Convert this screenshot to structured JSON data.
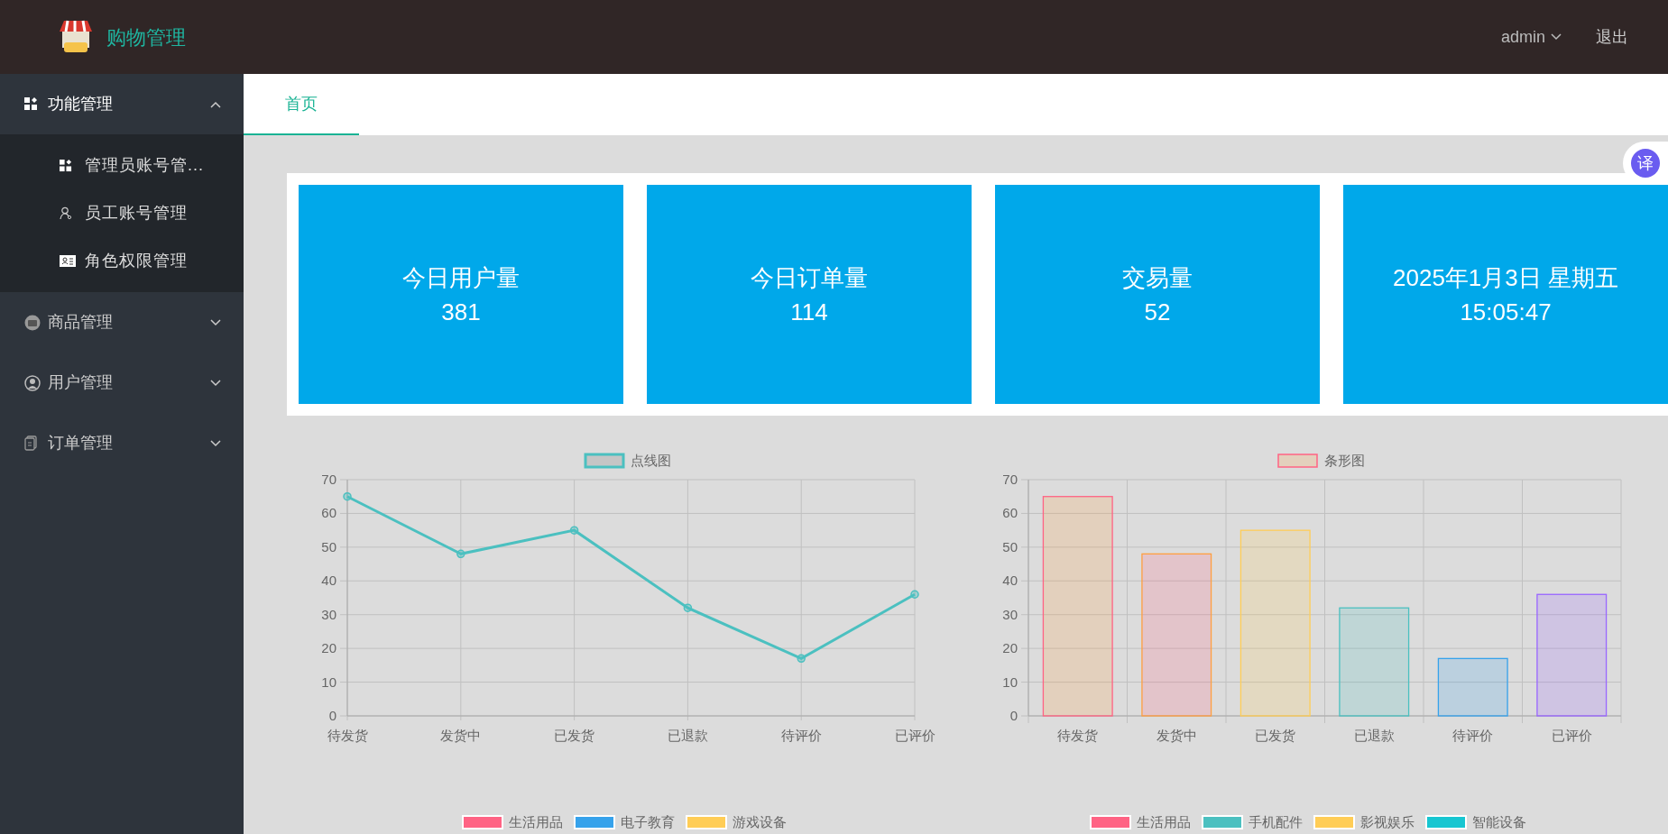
{
  "header": {
    "title": "购物管理",
    "user": "admin",
    "logout": "退出"
  },
  "sidebar": {
    "items": [
      {
        "label": "功能管理",
        "expanded": true,
        "children": [
          {
            "label": "管理员账号管..."
          },
          {
            "label": "员工账号管理"
          },
          {
            "label": "角色权限管理"
          }
        ]
      },
      {
        "label": "商品管理",
        "expanded": false
      },
      {
        "label": "用户管理",
        "expanded": false
      },
      {
        "label": "订单管理",
        "expanded": false
      }
    ]
  },
  "tabs": [
    {
      "label": "首页",
      "selected": true
    }
  ],
  "stat_cards": [
    {
      "title": "今日用户量",
      "value": "381"
    },
    {
      "title": "今日订单量",
      "value": "114"
    },
    {
      "title": "交易量",
      "value": "52"
    },
    {
      "title": "2025年1月3日 星期五",
      "value": "15:05:47"
    }
  ],
  "translate_button": {
    "label": "译"
  },
  "line_chart": {
    "chart_data": {
      "type": "line",
      "categories": [
        "待发货",
        "发货中",
        "已发货",
        "已退款",
        "待评价",
        "已评价"
      ],
      "series": [
        {
          "name": "点线图",
          "color": "#4bc0c0",
          "values": [
            65,
            48,
            55,
            32,
            17,
            36
          ],
          "marker": true
        }
      ],
      "grid": true,
      "ylim": [
        0,
        70
      ],
      "yticks": [
        0,
        10,
        20,
        30,
        40,
        50,
        60,
        70
      ]
    }
  },
  "bar_chart": {
    "chart_data": {
      "type": "bar",
      "categories": [
        "待发货",
        "发货中",
        "已发货",
        "已退款",
        "待评价",
        "已评价"
      ],
      "series": [
        {
          "name": "条形图",
          "values": [
            65,
            48,
            55,
            32,
            17,
            36
          ]
        }
      ],
      "grid": true,
      "ylim": [
        0,
        70
      ],
      "yticks": [
        0,
        10,
        20,
        30,
        40,
        50,
        60,
        70
      ]
    }
  },
  "lower_left_legend": [
    {
      "label": "生活用品",
      "color": "#ff6384"
    },
    {
      "label": "电子教育",
      "color": "#36a2eb"
    },
    {
      "label": "游戏设备",
      "color": "#ffcd56"
    }
  ],
  "lower_right_legend": [
    {
      "label": "生活用品",
      "color": "#ff6384"
    },
    {
      "label": "手机配件",
      "color": "#4bc0c0"
    },
    {
      "label": "影视娱乐",
      "color": "#ffcd56"
    },
    {
      "label": "智能设备",
      "color": "#17c6d1"
    }
  ]
}
